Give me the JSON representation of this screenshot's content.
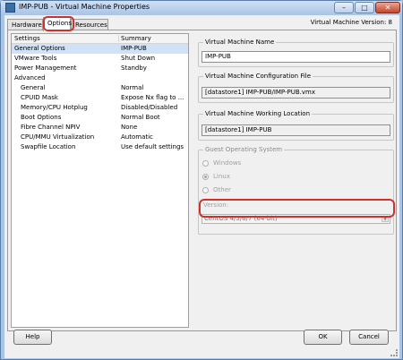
{
  "window": {
    "title": "IMP-PUB - Virtual Machine Properties",
    "icon": "vm-icon",
    "controls": {
      "minimize": "–",
      "maximize": "□",
      "close": "✕"
    }
  },
  "tabs": [
    {
      "label": "Hardware",
      "active": false
    },
    {
      "label": "Options",
      "active": true
    },
    {
      "label": "Resources",
      "active": false
    }
  ],
  "vm_version": "Virtual Machine Version: 8",
  "settings": {
    "headers": {
      "settings": "Settings",
      "summary": "Summary"
    },
    "rows": [
      {
        "name": "General Options",
        "summary": "IMP-PUB",
        "indent": false,
        "selected": true
      },
      {
        "name": "VMware Tools",
        "summary": "Shut Down",
        "indent": false,
        "selected": false
      },
      {
        "name": "Power Management",
        "summary": "Standby",
        "indent": false,
        "selected": false
      },
      {
        "name": "Advanced",
        "summary": "",
        "indent": false,
        "selected": false
      },
      {
        "name": "General",
        "summary": "Normal",
        "indent": true,
        "selected": false
      },
      {
        "name": "CPUID Mask",
        "summary": "Expose Nx flag to ...",
        "indent": true,
        "selected": false
      },
      {
        "name": "Memory/CPU Hotplug",
        "summary": "Disabled/Disabled",
        "indent": true,
        "selected": false
      },
      {
        "name": "Boot Options",
        "summary": "Normal Boot",
        "indent": true,
        "selected": false
      },
      {
        "name": "Fibre Channel NPIV",
        "summary": "None",
        "indent": true,
        "selected": false
      },
      {
        "name": "CPU/MMU Virtualization",
        "summary": "Automatic",
        "indent": true,
        "selected": false
      },
      {
        "name": "Swapfile Location",
        "summary": "Use default settings",
        "indent": true,
        "selected": false
      }
    ]
  },
  "details": {
    "vm_name": {
      "label": "Virtual Machine Name",
      "value": "IMP-PUB"
    },
    "config_file": {
      "label": "Virtual Machine Configuration File",
      "value": "[datastore1] IMP-PUB/IMP-PUB.vmx"
    },
    "working_location": {
      "label": "Virtual Machine Working Location",
      "value": "[datastore1] IMP-PUB"
    },
    "guest_os": {
      "label": "Guest Operating System",
      "options": [
        {
          "label": "Windows",
          "checked": false
        },
        {
          "label": "Linux",
          "checked": true
        },
        {
          "label": "Other",
          "checked": false
        }
      ],
      "version_label": "Version:",
      "version_value": "CentOS 4/5/6/7 (64-bit)"
    }
  },
  "buttons": {
    "help": "Help",
    "ok": "OK",
    "cancel": "Cancel"
  },
  "colors": {
    "highlight": "#d0312a",
    "selection": "#cfe2f7"
  }
}
